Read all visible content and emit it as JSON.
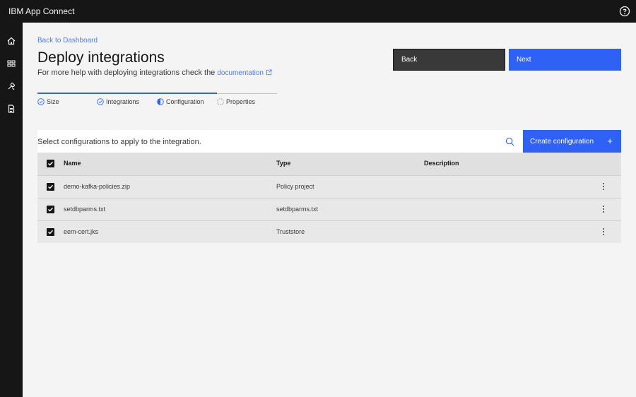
{
  "app": {
    "brand_bold": "IBM",
    "brand_name": "App Connect"
  },
  "header": {
    "help_icon": "help-icon"
  },
  "sidenav": {
    "items": [
      "home-icon",
      "dashboard-icon",
      "tools-icon",
      "document-icon"
    ]
  },
  "page": {
    "back_link": "Back to Dashboard",
    "title": "Deploy integrations",
    "help_prefix": "For more help with deploying integrations check the",
    "help_link": "documentation"
  },
  "actions": {
    "back_label": "Back",
    "next_label": "Next"
  },
  "steps": [
    {
      "label": "Size",
      "state": "complete"
    },
    {
      "label": "Integrations",
      "state": "complete"
    },
    {
      "label": "Configuration",
      "state": "current"
    },
    {
      "label": "Properties",
      "state": "incomplete"
    }
  ],
  "table": {
    "description": "Select configurations to apply to the integration.",
    "create_label": "Create configuration",
    "create_icon": "+",
    "headers": {
      "name": "Name",
      "type": "Type",
      "description": "Description"
    },
    "rows": [
      {
        "name": "demo-kafka-policies.zip",
        "type": "Policy project",
        "description": "",
        "checked": true
      },
      {
        "name": "setdbparms.txt",
        "type": "setdbparms.txt",
        "description": "",
        "checked": true
      },
      {
        "name": "eem-cert.jks",
        "type": "Truststore",
        "description": "",
        "checked": true
      }
    ]
  },
  "colors": {
    "primary": "#2f62f4",
    "link": "#4b7ce8",
    "shell": "#161616"
  }
}
